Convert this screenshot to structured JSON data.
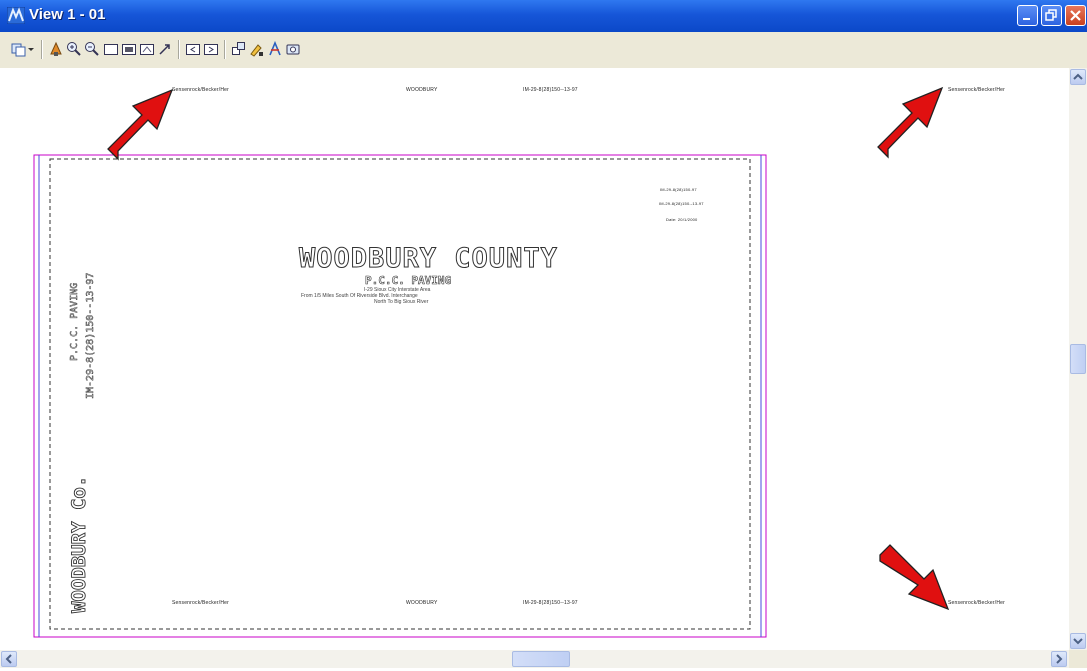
{
  "window": {
    "title": "View 1 - 01",
    "colors": {
      "titlebar": "#1656d8",
      "close": "#c8401f",
      "annotation_arrow": "#e01010",
      "sheet_border": "#c800c8"
    }
  },
  "toolbar": {
    "icons": [
      "view-groups-icon",
      "dropdown-icon",
      "update-view-icon",
      "zoom-in-icon",
      "zoom-out-icon",
      "window-area-icon",
      "fit-view-icon",
      "rotate-view-icon",
      "pan-view-icon",
      "view-previous-icon",
      "view-next-icon",
      "copy-view-icon",
      "view-attributes-icon",
      "level-display-icon",
      "camera-icon"
    ]
  },
  "sheet": {
    "header_left": "Sensenrock/Becker/Her",
    "header_mid": "WOODBURY",
    "header_right": "IM-29-8(28)150--13-97",
    "far_right_top": "Sensenrock/Becker/Her",
    "far_right_bottom": "Sensenrock/Becker/Her",
    "footer_left": "Sensenrock/Becker/Her",
    "footer_mid": "WOODBURY",
    "footer_right": "IM-29-8(28)150--13-97",
    "stamp": [
      "IM-29-8(28)150-97",
      "IM-29-8(28)150--13-97",
      "Date: 20/1/2000"
    ],
    "main_title": "WOODBURY COUNTY",
    "sub_title": "P.C.C. PAVING",
    "desc": [
      "I-29 Sioux City Interstate Area",
      "From 1/5 Miles South Of Riverside Blvd. Interchange",
      "North To Big Sioux River"
    ],
    "left_vertical_1": "P.C.C. PAVING",
    "left_vertical_2": "IM-29-8(28)150--13-97",
    "left_vertical_big": "WOODBURY Co."
  }
}
